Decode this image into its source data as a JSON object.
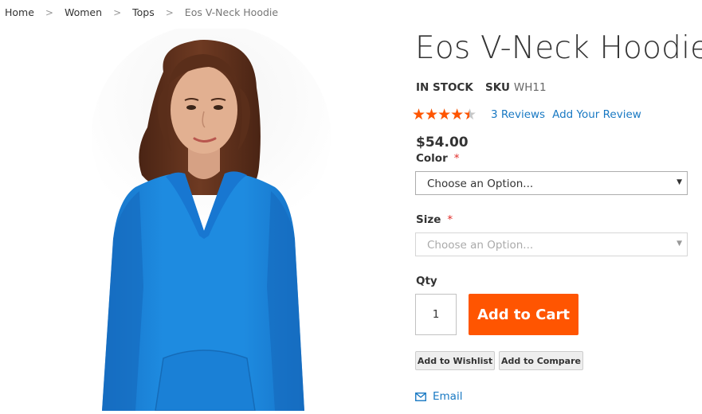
{
  "breadcrumb": {
    "items": [
      "Home",
      "Women",
      "Tops"
    ],
    "current": "Eos V-Neck Hoodie",
    "separator": ">"
  },
  "gallery": {
    "image_alt": "Eos V-Neck Hoodie product photo - blue v-neck hoodie"
  },
  "product": {
    "title": "Eos V-Neck Hoodie",
    "stock": "IN STOCK",
    "sku_label": "SKU",
    "sku_value": "WH11",
    "rating_stars": "★★★★★",
    "rating_fraction": 0.8,
    "rating_color": "#ff5501",
    "reviews_link": "3 Reviews",
    "add_review_link": "Add Your Review",
    "price": "$54.00"
  },
  "options": {
    "color_label": "Color",
    "color_placeholder": "Choose an Option...",
    "size_label": "Size",
    "size_placeholder": "Choose an Option...",
    "required_marker": "*",
    "arrow": "▼"
  },
  "cart": {
    "qty_label": "Qty",
    "qty_value": "1",
    "add_to_cart": "Add to Cart",
    "button_color": "#ff5501"
  },
  "actions": {
    "wishlist": "Add to Wishlist",
    "compare": "Add to Compare",
    "email": "Email",
    "email_icon": "envelope-icon"
  },
  "colors": {
    "link": "#1979c3",
    "required": "#e02b27",
    "hoodie": "#1e8be0"
  }
}
